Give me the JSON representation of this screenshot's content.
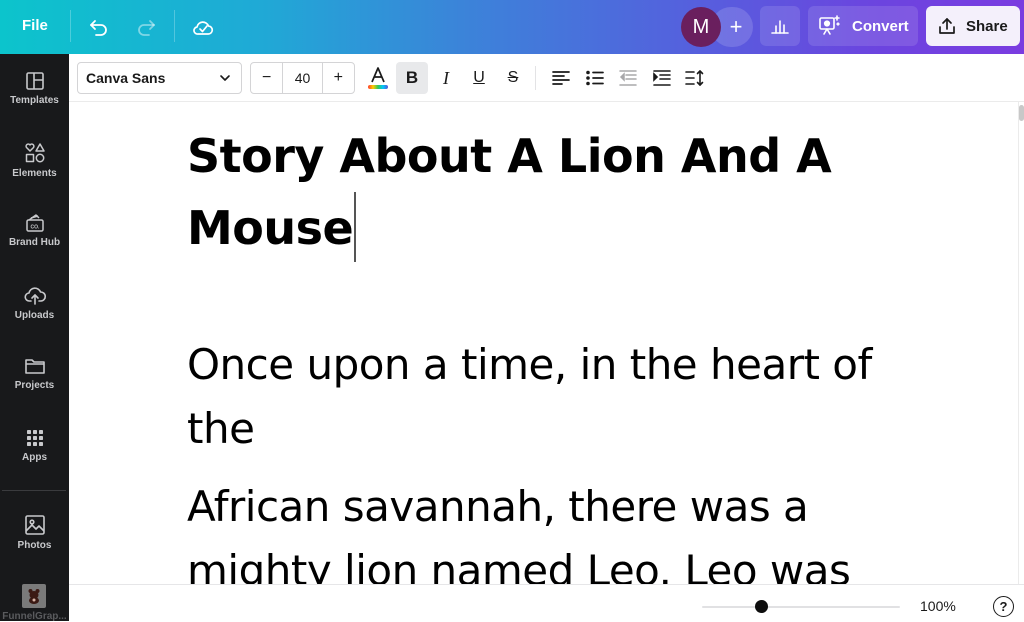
{
  "topbar": {
    "file_label": "File",
    "undo_icon": "undo-icon",
    "redo_icon": "redo-icon",
    "save_status_icon": "cloud-check-icon",
    "avatar_initial": "M",
    "avatar_color": "#6a1f5e",
    "add_collaborator_label": "+",
    "insights_icon": "bar-chart-icon",
    "convert_label": "Convert",
    "share_label": "Share"
  },
  "sidebar": {
    "items": [
      {
        "label": "Templates",
        "icon": "templates-icon"
      },
      {
        "label": "Elements",
        "icon": "elements-icon"
      },
      {
        "label": "Brand Hub",
        "icon": "brand-hub-icon"
      },
      {
        "label": "Uploads",
        "icon": "upload-cloud-icon"
      },
      {
        "label": "Projects",
        "icon": "folder-icon"
      },
      {
        "label": "Apps",
        "icon": "apps-grid-icon"
      },
      {
        "label": "Photos",
        "icon": "image-icon"
      },
      {
        "label": "FunnelGrap...",
        "icon": "funnelgraph-app-icon"
      }
    ]
  },
  "toolbar": {
    "font_family": "Canva Sans",
    "font_size": "40",
    "decrease_label": "−",
    "increase_label": "+",
    "bold_active": true
  },
  "document": {
    "title": "Story About A Lion And A Mouse",
    "paragraphs": [
      "Once upon a time, in the heart of the",
      "African savannah, there was a mighty lion named Leo. Leo was"
    ]
  },
  "footer": {
    "zoom_percent": "100%",
    "zoom_slider_fraction": 0.3,
    "help_label": "?"
  }
}
